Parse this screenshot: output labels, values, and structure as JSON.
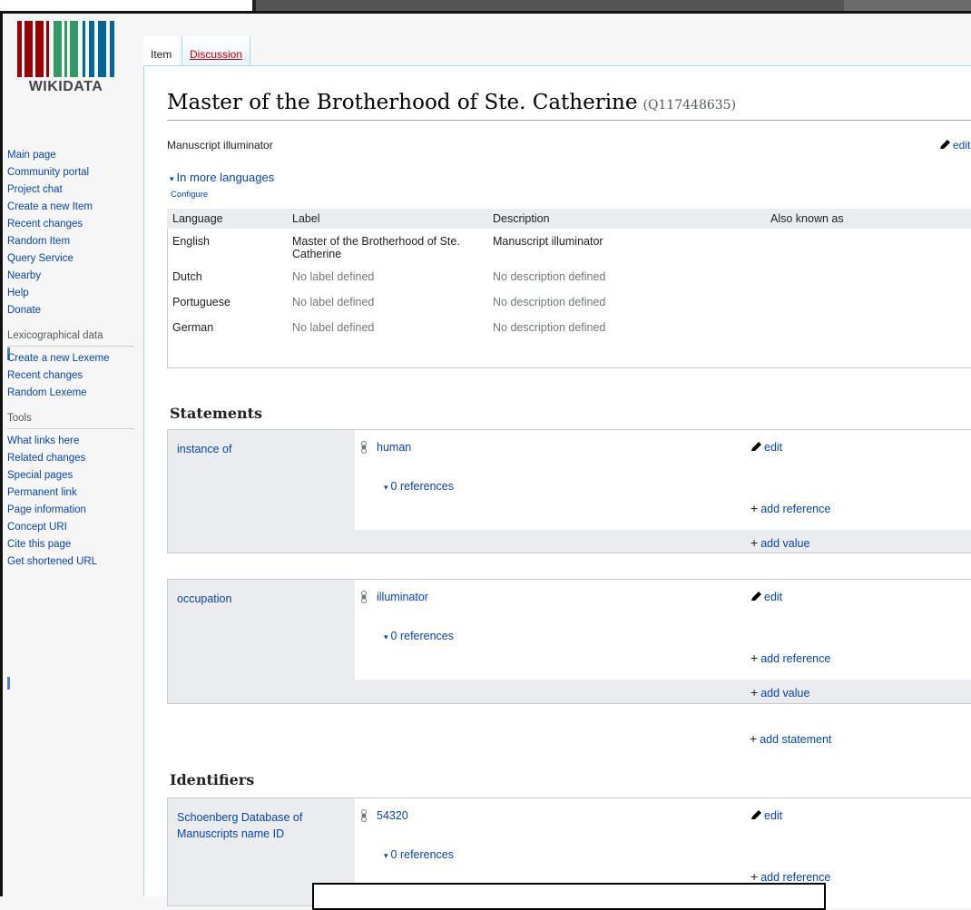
{
  "logo": {
    "wordmark": "WIKIDATA"
  },
  "sidebar": {
    "nav": [
      "Main page",
      "Community portal",
      "Project chat",
      "Create a new Item",
      "Recent changes",
      "Random Item",
      "Query Service",
      "Nearby",
      "Help",
      "Donate"
    ],
    "lexeme_heading": "Lexicographical data",
    "lexeme_items": [
      "Create a new Lexeme",
      "Recent changes",
      "Random Lexeme"
    ],
    "tools_heading": "Tools",
    "tools_items": [
      "What links here",
      "Related changes",
      "Special pages",
      "Permanent link",
      "Page information",
      "Concept URI",
      "Cite this page",
      "Get shortened URL"
    ]
  },
  "tabs": {
    "item": "Item",
    "discussion": "Discussion"
  },
  "title": {
    "label": "Master of the Brotherhood of Ste. Catherine",
    "qid": "(Q117448635)"
  },
  "description": "Manuscript illuminator",
  "edit_label": "edit",
  "languages": {
    "toggle": "In more languages",
    "configure": "Configure",
    "headers": [
      "Language",
      "Label",
      "Description",
      "Also known as"
    ],
    "rows": [
      {
        "language": "English",
        "label": "Master of the Brotherhood of Ste. Catherine",
        "description": "Manuscript illuminator",
        "aliases": "",
        "label_placeholder": false,
        "desc_placeholder": false
      },
      {
        "language": "Dutch",
        "label": "No label defined",
        "description": "No description defined",
        "aliases": "",
        "label_placeholder": true,
        "desc_placeholder": true
      },
      {
        "language": "Portuguese",
        "label": "No label defined",
        "description": "No description defined",
        "aliases": "",
        "label_placeholder": true,
        "desc_placeholder": true
      },
      {
        "language": "German",
        "label": "No label defined",
        "description": "No description defined",
        "aliases": "",
        "label_placeholder": true,
        "desc_placeholder": true
      }
    ]
  },
  "statements": {
    "heading": "Statements",
    "items": [
      {
        "property": "instance of",
        "value": "human",
        "references": "0 references",
        "add_reference": "add reference",
        "add_value": "add value"
      },
      {
        "property": "occupation",
        "value": "illuminator",
        "references": "0 references",
        "add_reference": "add reference",
        "add_value": "add value"
      }
    ],
    "add_statement": "add statement"
  },
  "identifiers": {
    "heading": "Identifiers",
    "items": [
      {
        "property": "Schoenberg Database of Manuscripts name ID",
        "value": "54320",
        "references": "0 references",
        "add_reference": "add reference"
      }
    ]
  },
  "colors": {
    "link": "#0645ad",
    "new_link": "#ba0000",
    "placeholder": "#72777d",
    "panel": "#eaecf0"
  }
}
